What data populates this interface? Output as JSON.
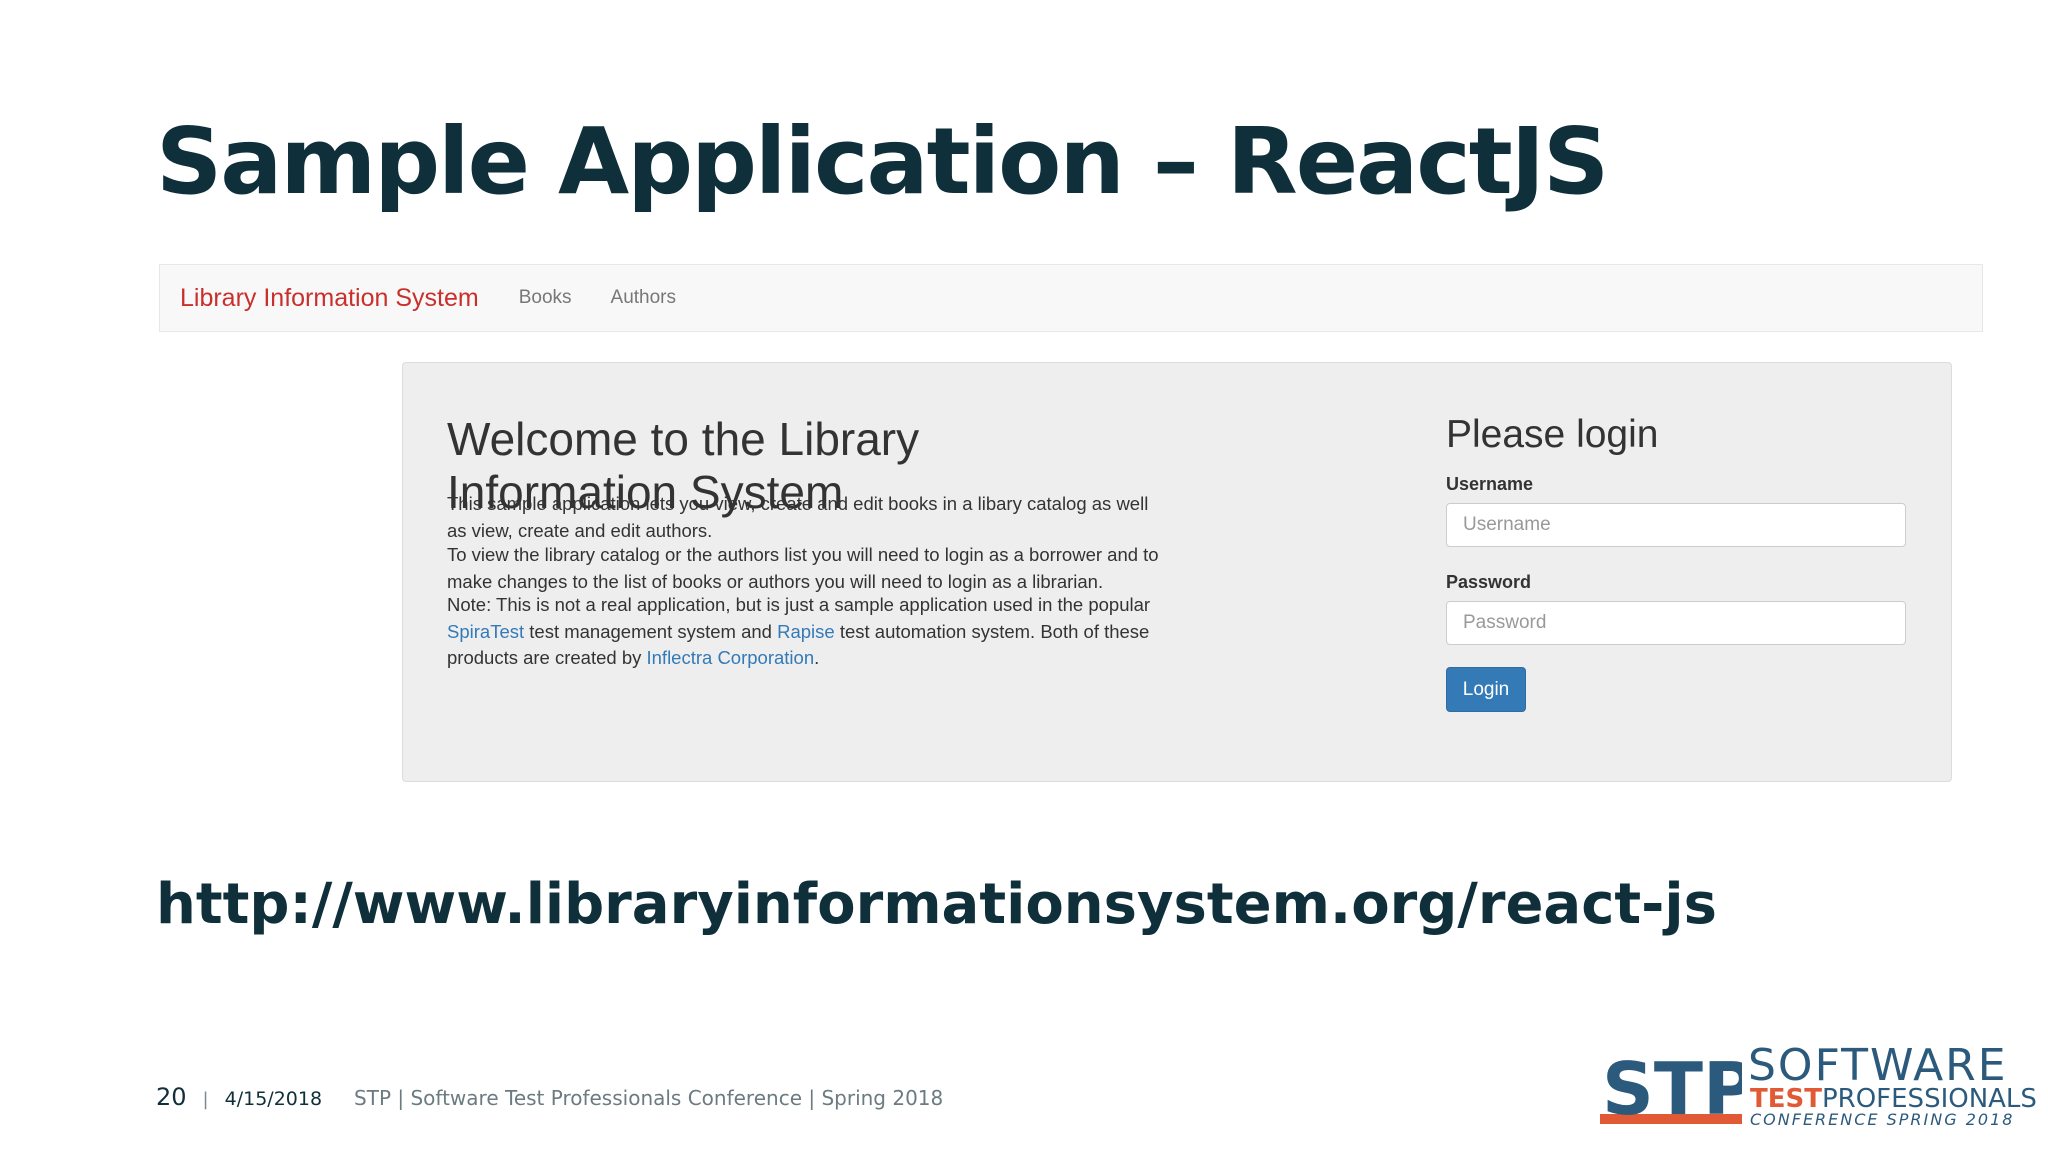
{
  "slide": {
    "title": "Sample Application – ReactJS",
    "url": "http://www.libraryinformationsystem.org/react-js"
  },
  "app": {
    "brand": "Library Information System",
    "nav": [
      "Books",
      "Authors"
    ],
    "welcome_heading_line1": "Welcome to the Library",
    "welcome_heading_line2": "Information System",
    "para1": "This sample application lets you view, create and edit books in a libary catalog as well as view, create and edit authors.",
    "para2": "To view the library catalog or the authors list you will need to login as a borrower and to make changes to the list of books or authors you will need to login as a librarian.",
    "para3": {
      "t1": "Note: This is not a real application, but is just a sample application used in the popular ",
      "link1": "SpiraTest",
      "t2": " test management system and ",
      "link2": "Rapise",
      "t3": " test automation system. Both of these products are created by ",
      "link3": "Inflectra Corporation",
      "t4": "."
    },
    "login": {
      "heading": "Please login",
      "username_label": "Username",
      "username_placeholder": "Username",
      "password_label": "Password",
      "password_placeholder": "Password",
      "button": "Login"
    }
  },
  "footer": {
    "page_number": "20",
    "separator": "|",
    "date": "4/15/2018",
    "conference": "STP | Software Test Professionals Conference | Spring 2018"
  },
  "logo": {
    "letters": "STP",
    "line1": "SOFTWARE",
    "line2_test": "TEST",
    "line2_rest": "PROFESSIONALS",
    "line3": "CONFERENCE SPRING 2018"
  },
  "colors": {
    "title": "#0f2f3a",
    "brand": "#c9302c",
    "link": "#337ab7",
    "button": "#337ab7",
    "logo_blue": "#2c5a7c",
    "logo_orange": "#e25a35"
  }
}
